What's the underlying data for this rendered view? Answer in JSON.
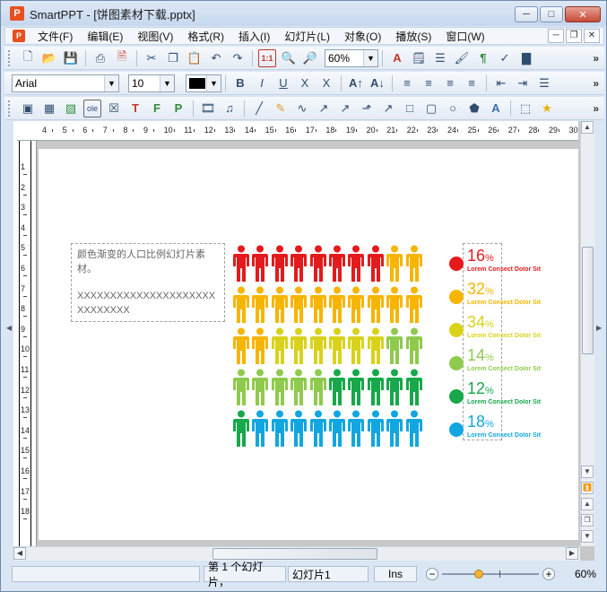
{
  "window": {
    "app_name": "SmartPPT",
    "title": "SmartPPT - [饼图素材下载.pptx]",
    "app_icon_letter": "P"
  },
  "menu": {
    "items": [
      "文件(F)",
      "编辑(E)",
      "视图(V)",
      "格式(R)",
      "插入(I)",
      "幻灯片(L)",
      "对象(O)",
      "播放(S)",
      "窗口(W)"
    ]
  },
  "toolbar1": {
    "zoom_value": "60%"
  },
  "toolbar2": {
    "font_name": "Arial",
    "font_size": "10",
    "font_color": "#000000"
  },
  "ruler": {
    "h_ticks": [
      "4",
      "5",
      "6",
      "7",
      "8",
      "9",
      "10",
      "11",
      "12",
      "13",
      "14",
      "15",
      "16",
      "17",
      "18",
      "19",
      "20",
      "21",
      "22",
      "23",
      "24",
      "25",
      "26",
      "27",
      "28",
      "29",
      "30"
    ],
    "v_ticks": [
      "1",
      "2",
      "3",
      "4",
      "5",
      "6",
      "7",
      "8",
      "9",
      "10",
      "11",
      "12",
      "13",
      "14",
      "15",
      "16",
      "17",
      "18"
    ]
  },
  "slide": {
    "textbox_line1": "颜色渐变的人口比例幻灯片素材。",
    "textbox_line2": "XXXXXXXXXXXXXXXXXXXXXXXXXXXXX",
    "people_rows": [
      [
        "#e41a1c",
        "#e41a1c",
        "#e41a1c",
        "#e41a1c",
        "#e41a1c",
        "#e41a1c",
        "#e41a1c",
        "#e41a1c",
        "#f7b500",
        "#f7b500"
      ],
      [
        "#f7b500",
        "#f7b500",
        "#f7b500",
        "#f7b500",
        "#f7b500",
        "#f7b500",
        "#f7b500",
        "#f7b500",
        "#f7b500",
        "#f7b500"
      ],
      [
        "#f7b500",
        "#f7b500",
        "#d9d21b",
        "#d9d21b",
        "#d9d21b",
        "#d9d21b",
        "#d9d21b",
        "#d9d21b",
        "#8fca4d",
        "#8fca4d"
      ],
      [
        "#8fca4d",
        "#8fca4d",
        "#8fca4d",
        "#8fca4d",
        "#8fca4d",
        "#16a84a",
        "#16a84a",
        "#16a84a",
        "#16a84a",
        "#16a84a"
      ],
      [
        "#16a84a",
        "#11a6e0",
        "#11a6e0",
        "#11a6e0",
        "#11a6e0",
        "#11a6e0",
        "#11a6e0",
        "#11a6e0",
        "#11a6e0",
        "#11a6e0"
      ]
    ],
    "legend": [
      {
        "pct": "16",
        "unit": "%",
        "sub": "Lorem Consect Dolor Sit",
        "color": "#e41a1c"
      },
      {
        "pct": "32",
        "unit": "%",
        "sub": "Lorem Consect Dolor Sit",
        "color": "#f7b500"
      },
      {
        "pct": "34",
        "unit": "%",
        "sub": "Lorem Consect Dolor Sit",
        "color": "#d9d21b"
      },
      {
        "pct": "14",
        "unit": "%",
        "sub": "Lorem Consect Dolor Sit",
        "color": "#8fca4d"
      },
      {
        "pct": "12",
        "unit": "%",
        "sub": "Lorem Consect Dolor Sit",
        "color": "#16a84a"
      },
      {
        "pct": "18",
        "unit": "%",
        "sub": "Lorem Consect Dolor Sit",
        "color": "#11a6e0"
      }
    ]
  },
  "status": {
    "slide_index": "第 1 个幻灯片，",
    "slide_name": "幻灯片1",
    "mode": "Ins",
    "zoom": "60%"
  }
}
